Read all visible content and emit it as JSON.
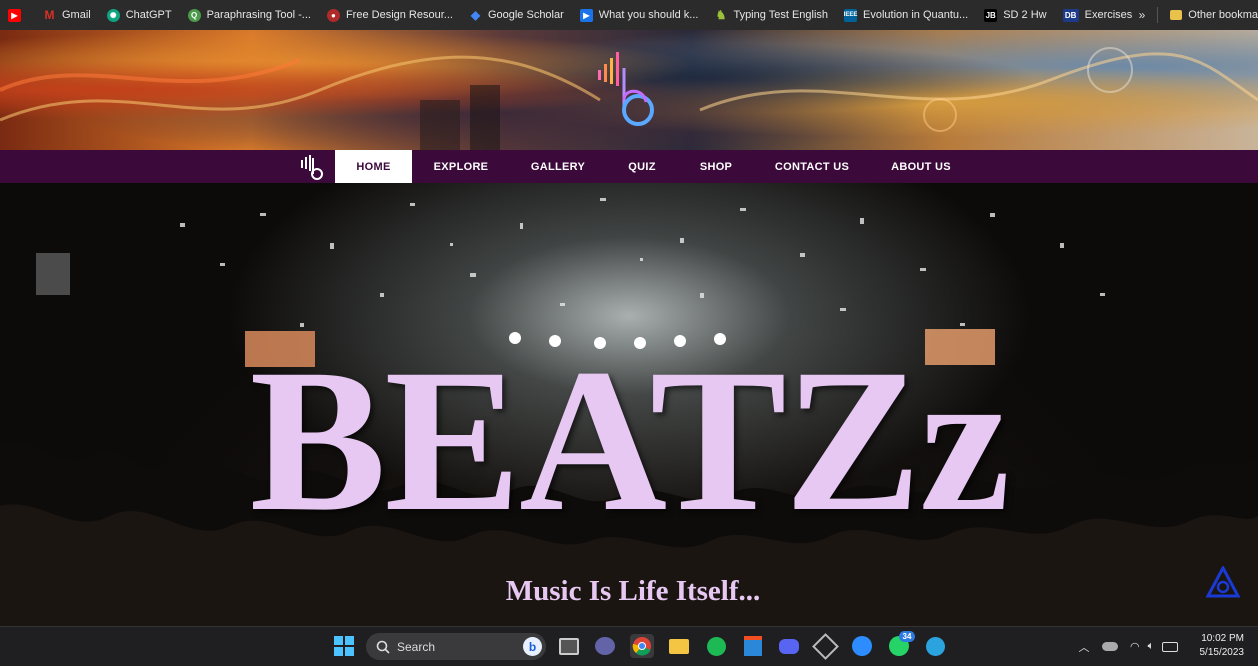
{
  "bookmarks": {
    "items": [
      {
        "label": "",
        "icon": "youtube-icon",
        "color": "#ff0000"
      },
      {
        "label": "Gmail",
        "icon": "gmail-icon",
        "color": "#d93025"
      },
      {
        "label": "ChatGPT",
        "icon": "chatgpt-icon",
        "color": "#10a37f"
      },
      {
        "label": "Paraphrasing Tool -...",
        "icon": "quillbot-icon",
        "color": "#4a9a4a"
      },
      {
        "label": "Free Design Resour...",
        "icon": "freepik-icon",
        "color": "#b02a2a"
      },
      {
        "label": "Google Scholar",
        "icon": "scholar-icon",
        "color": "#4285f4"
      },
      {
        "label": "What you should k...",
        "icon": "video-icon",
        "color": "#1a73e8"
      },
      {
        "label": "Typing Test English",
        "icon": "typing-icon",
        "color": "#6b8e23"
      },
      {
        "label": "Evolution in Quantu...",
        "icon": "ieee-icon",
        "color": "#00629b"
      },
      {
        "label": "SD 2 Hw",
        "icon": "jb-icon",
        "color": "#000000",
        "glyph": "JB"
      },
      {
        "label": "Exercises",
        "icon": "db-icon",
        "color": "#1e3a8a",
        "glyph": "DB"
      }
    ],
    "more": "»",
    "other": "Other bookma"
  },
  "nav": {
    "items": [
      "HOME",
      "EXPLORE",
      "GALLERY",
      "QUIZ",
      "SHOP",
      "CONTACT US",
      "ABOUT US"
    ],
    "active": "HOME"
  },
  "hero": {
    "title": "BEATZz",
    "subtitle": "Music Is Life Itself..."
  },
  "taskbar": {
    "search_placeholder": "Search",
    "whatsapp_badge": "34",
    "time": "10:02 PM",
    "date": "5/15/2023"
  },
  "colors": {
    "nav_bg": "#3b0a3a",
    "title": "#e6c8f2",
    "accent_blue": "#1a3ad6"
  }
}
